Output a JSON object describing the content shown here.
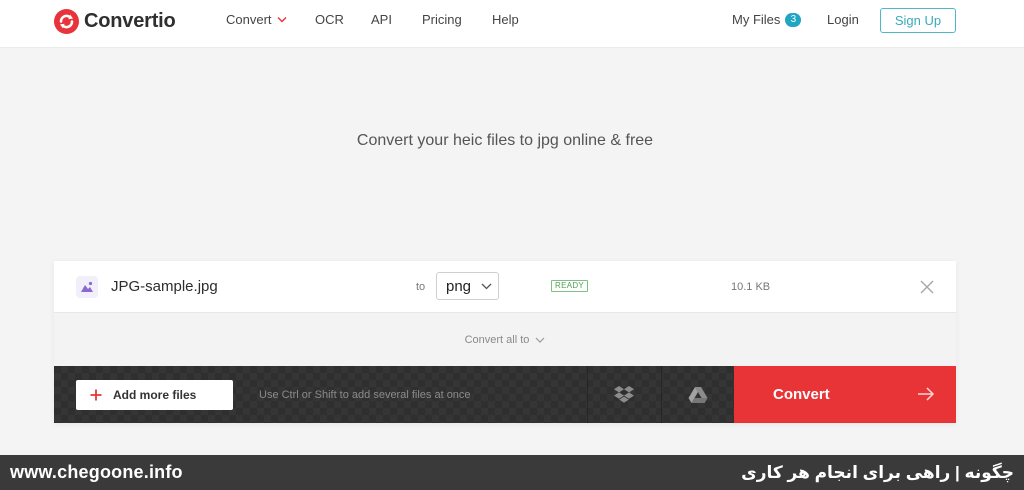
{
  "header": {
    "logo_text": "Convertio",
    "nav": {
      "convert": "Convert",
      "ocr": "OCR",
      "api": "API",
      "pricing": "Pricing",
      "help": "Help"
    },
    "my_files": {
      "label": "My Files",
      "count": "3"
    },
    "login": "Login",
    "signup": "Sign Up"
  },
  "hero": {
    "tagline": "Convert your heic files to jpg online & free"
  },
  "converter": {
    "file": {
      "name": "JPG-sample.jpg",
      "to_label": "to",
      "format": "png",
      "status": "READY",
      "size": "10.1 KB"
    },
    "convert_all": "Convert all to",
    "add_more": "Add more files",
    "hint": "Use Ctrl or Shift to add several files at once",
    "convert_button": "Convert"
  },
  "watermark": {
    "url": "www.chegoone.info",
    "persian_text": "چگونه | راهی برای انجام هر کاری"
  },
  "colors": {
    "brand_red": "#e83437",
    "accent_teal": "#3aaabc",
    "ready_green": "#4f9f55"
  },
  "icons": {
    "logo": "convertio-logo-icon",
    "file": "image-file-icon",
    "remove": "close-icon",
    "add": "plus-icon",
    "dropbox": "dropbox-icon",
    "drive": "google-drive-icon",
    "convert": "arrow-right-icon"
  }
}
